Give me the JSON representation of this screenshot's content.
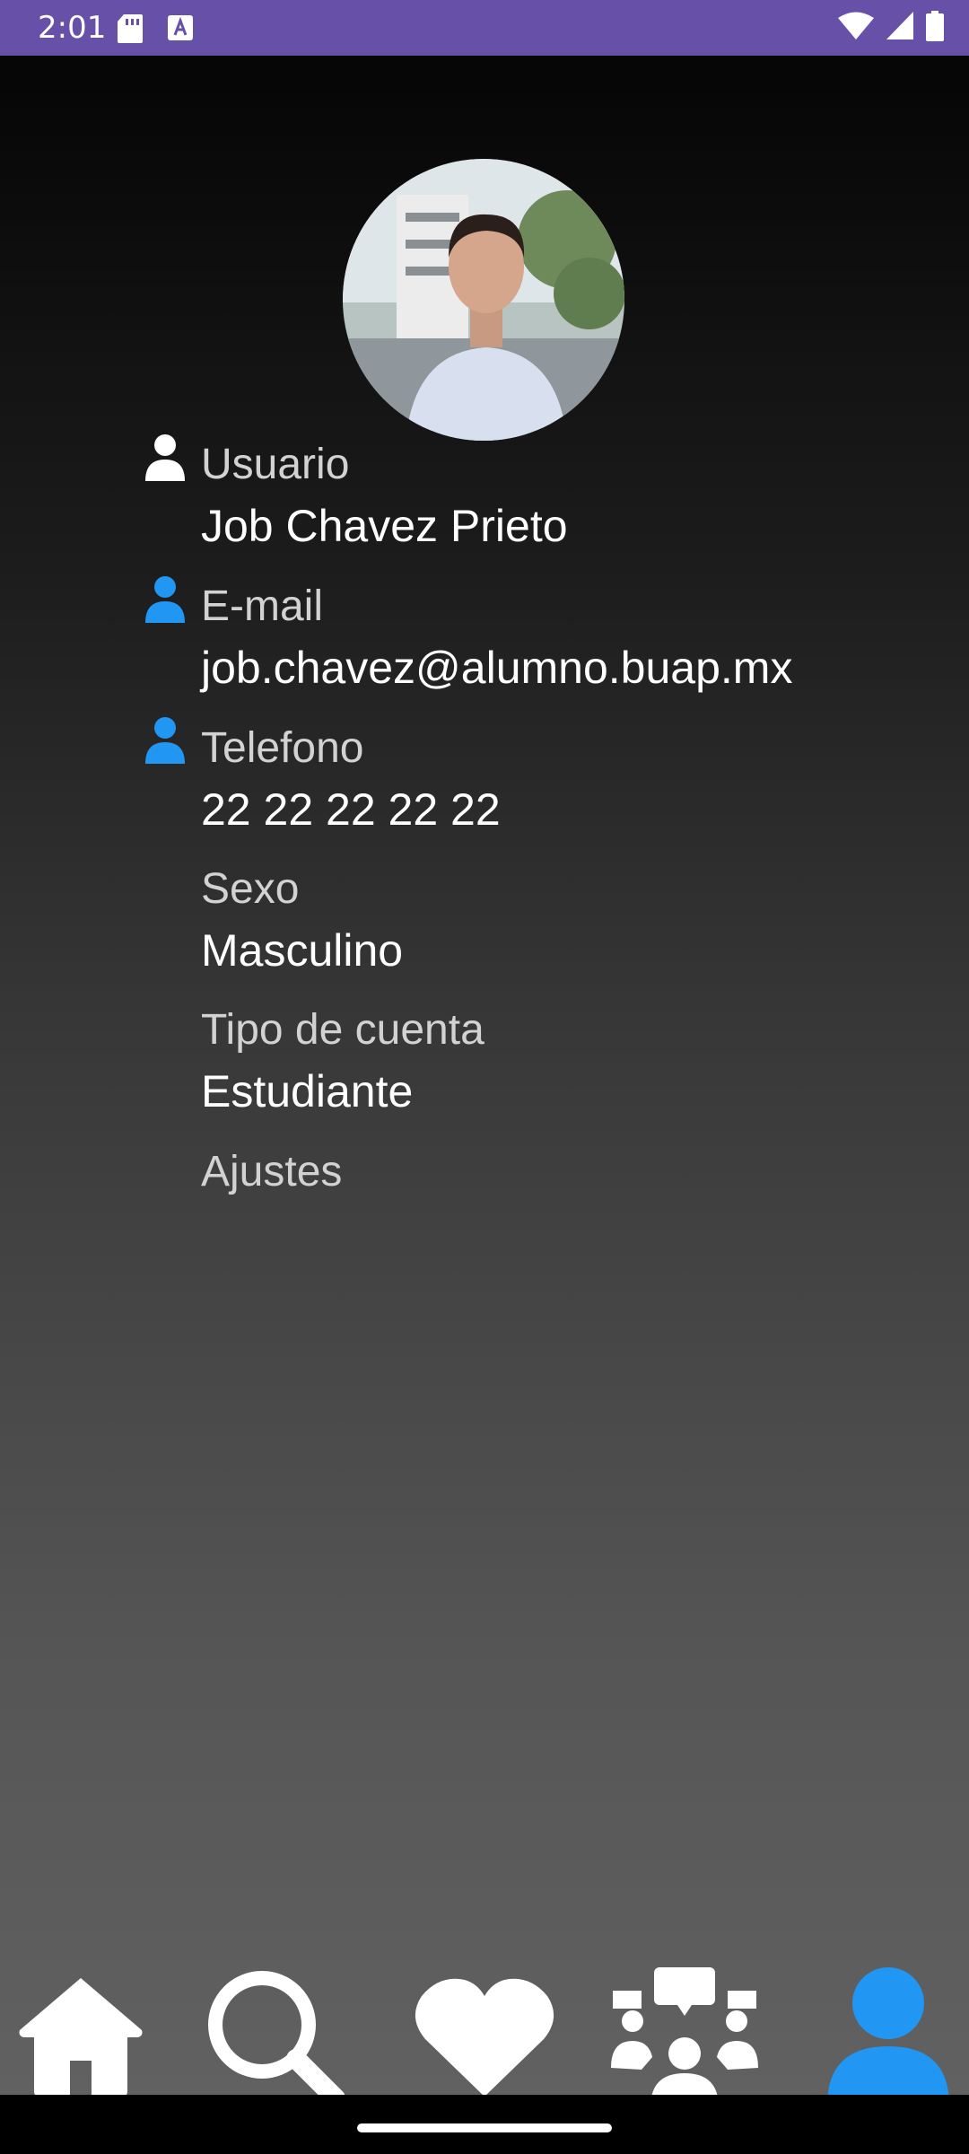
{
  "status_bar": {
    "time": "2:01",
    "bg_color": "#6750a8",
    "icons": [
      "sd-card-icon",
      "keyboard-a-icon",
      "wifi-icon",
      "signal-icon",
      "battery-icon"
    ]
  },
  "profile": {
    "photo": "profile-photo",
    "fields": [
      {
        "label": "Usuario",
        "value": "Job Chavez Prieto",
        "icon": "user-icon",
        "icon_color": "#ffffff"
      },
      {
        "label": "E-mail",
        "value": "job.chavez@alumno.buap.mx",
        "icon": "user-icon",
        "icon_color": "#2196f3"
      },
      {
        "label": "Telefono",
        "value": "22 22 22 22 22",
        "icon": "user-icon",
        "icon_color": "#2196f3"
      },
      {
        "label": "Sexo",
        "value": "Masculino"
      },
      {
        "label": "Tipo de cuenta",
        "value": "Estudiante"
      }
    ],
    "settings_label": "Ajustes"
  },
  "bottom_nav": {
    "items": [
      {
        "icon": "home-icon",
        "selected": false
      },
      {
        "icon": "search-icon",
        "selected": false
      },
      {
        "icon": "heart-icon",
        "selected": false
      },
      {
        "icon": "community-icon",
        "selected": false
      },
      {
        "icon": "profile-icon",
        "selected": true
      }
    ],
    "accent_color": "#2196f3",
    "inactive_color": "#ffffff"
  }
}
